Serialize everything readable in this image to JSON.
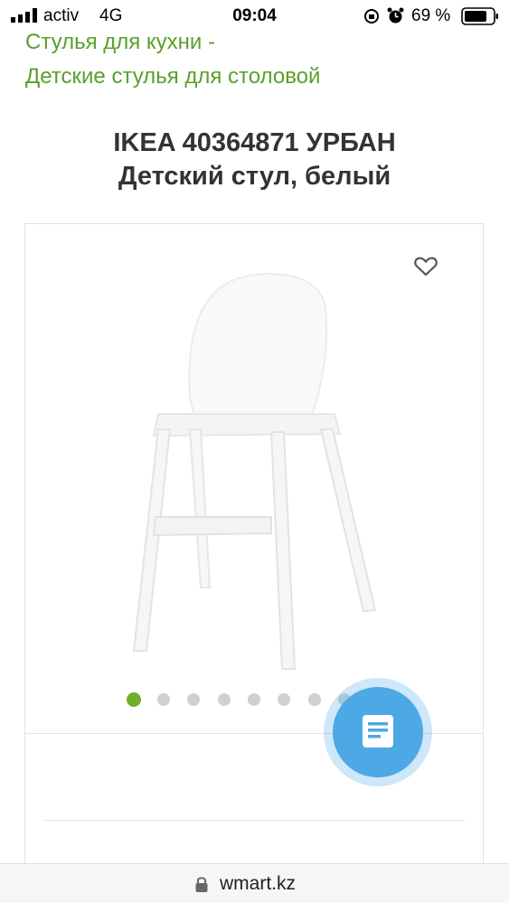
{
  "status_bar": {
    "carrier": "activ",
    "network": "4G",
    "time": "09:04",
    "battery_percent": "69 %",
    "icons": [
      "signal-icon",
      "rotation-lock-icon",
      "alarm-icon",
      "battery-icon"
    ]
  },
  "breadcrumb": {
    "line1": "Стулья для кухни -",
    "line2": "Детские стулья для столовой"
  },
  "product": {
    "title_line1": "IKEA 40364871 УРБАН",
    "title_line2": "Детский стул, белый",
    "image_subject": "white children's high chair",
    "gallery_dot_count": 8,
    "active_dot_index": 0
  },
  "fab": {
    "icon": "document-icon"
  },
  "address_bar": {
    "url": "wmart.kz"
  },
  "colors": {
    "breadcrumb": "#5aa02c",
    "active_dot": "#6fae2e",
    "fab": "#4da8e6"
  }
}
